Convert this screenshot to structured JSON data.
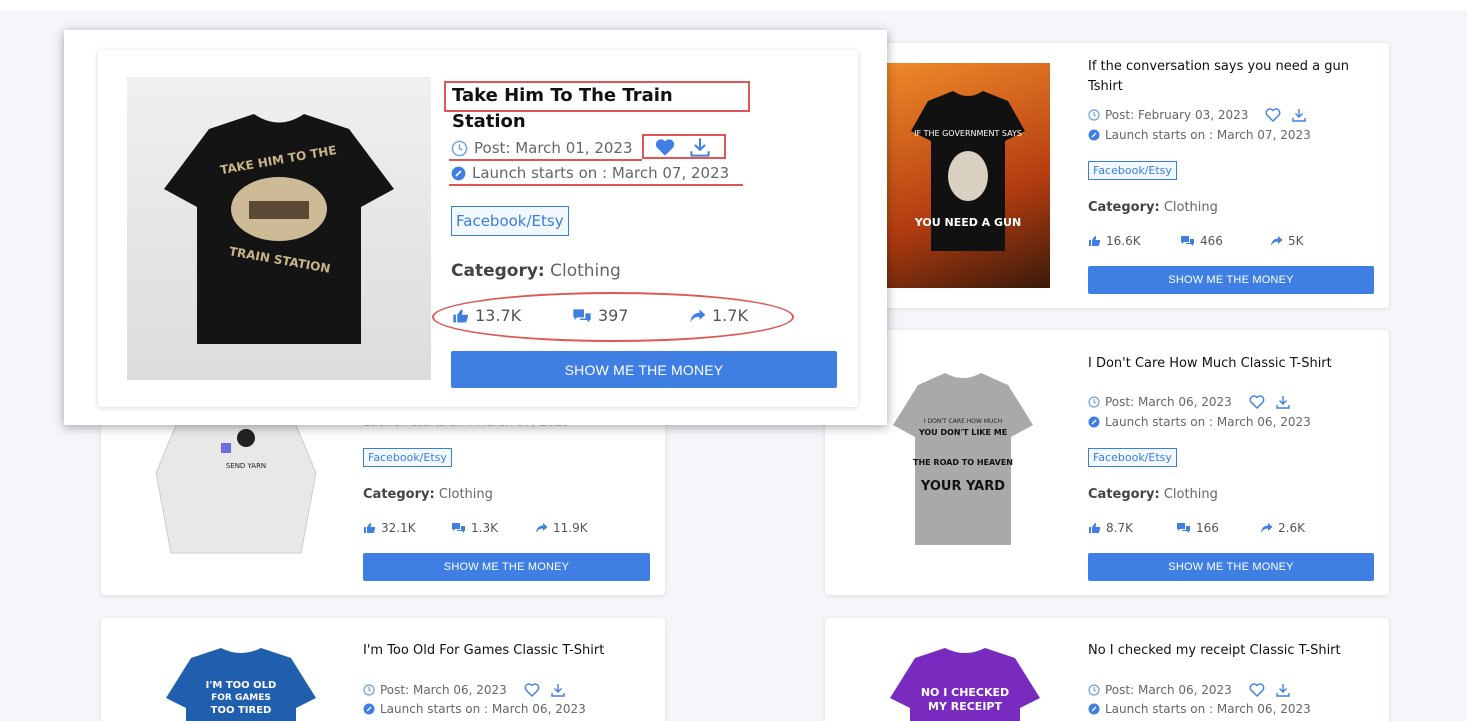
{
  "cards": [
    {
      "title": "If the conversation says you need a gun Tshirt",
      "post": "Post: February 03, 2023",
      "launch": "Launch starts on : March 07, 2023",
      "tag": "Facebook/Etsy",
      "category_label": "Category:",
      "category": "Clothing",
      "likes": "16.6K",
      "comments": "466",
      "shares": "5K",
      "button": "SHOW ME THE MONEY",
      "shirt_text": "IF THE GOVERNMENT SAYS / YOU NEED A GUN"
    },
    {
      "title": "",
      "post": "",
      "launch": "Launch starts on : March 07, 2023",
      "tag": "Facebook/Etsy",
      "category_label": "Category:",
      "category": "Clothing",
      "likes": "32.1K",
      "comments": "1.3K",
      "shares": "11.9K",
      "button": "SHOW ME THE MONEY",
      "shirt_text": "SEND YARN"
    },
    {
      "title": "I Don't Care How Much Classic T-Shirt",
      "post": "Post: March 06, 2023",
      "launch": "Launch starts on : March 06, 2023",
      "tag": "Facebook/Etsy",
      "category_label": "Category:",
      "category": "Clothing",
      "likes": "8.7K",
      "comments": "166",
      "shares": "2.6K",
      "button": "SHOW ME THE MONEY",
      "shirt_text": "YOUR YARD"
    },
    {
      "title": "I'm Too Old For Games Classic T-Shirt",
      "post": "Post: March 06, 2023",
      "launch": "Launch starts on : March 06, 2023",
      "shirt_text": "I'M TOO OLD FOR GAMES TOO TIRED"
    },
    {
      "title": "No I checked my receipt Classic T-Shirt",
      "post": "Post: March 06, 2023",
      "launch": "Launch starts on : March 06, 2023",
      "shirt_text": "NO I CHECKED MY RECEIPT"
    }
  ],
  "featured": {
    "title": "Take Him To The Train Station",
    "post": "Post: March 01, 2023",
    "launch": "Launch starts on : March 07, 2023",
    "tag": "Facebook/Etsy",
    "category_label": "Category:",
    "category": "Clothing",
    "likes": "13.7K",
    "comments": "397",
    "shares": "1.7K",
    "button": "SHOW ME THE MONEY",
    "shirt_text_top": "TAKE HIM TO THE",
    "shirt_text_bottom": "TRAIN STATION"
  },
  "colors": {
    "accent": "#3f7fe3",
    "highlight": "#e05555",
    "tag": "#3b7ddd"
  }
}
